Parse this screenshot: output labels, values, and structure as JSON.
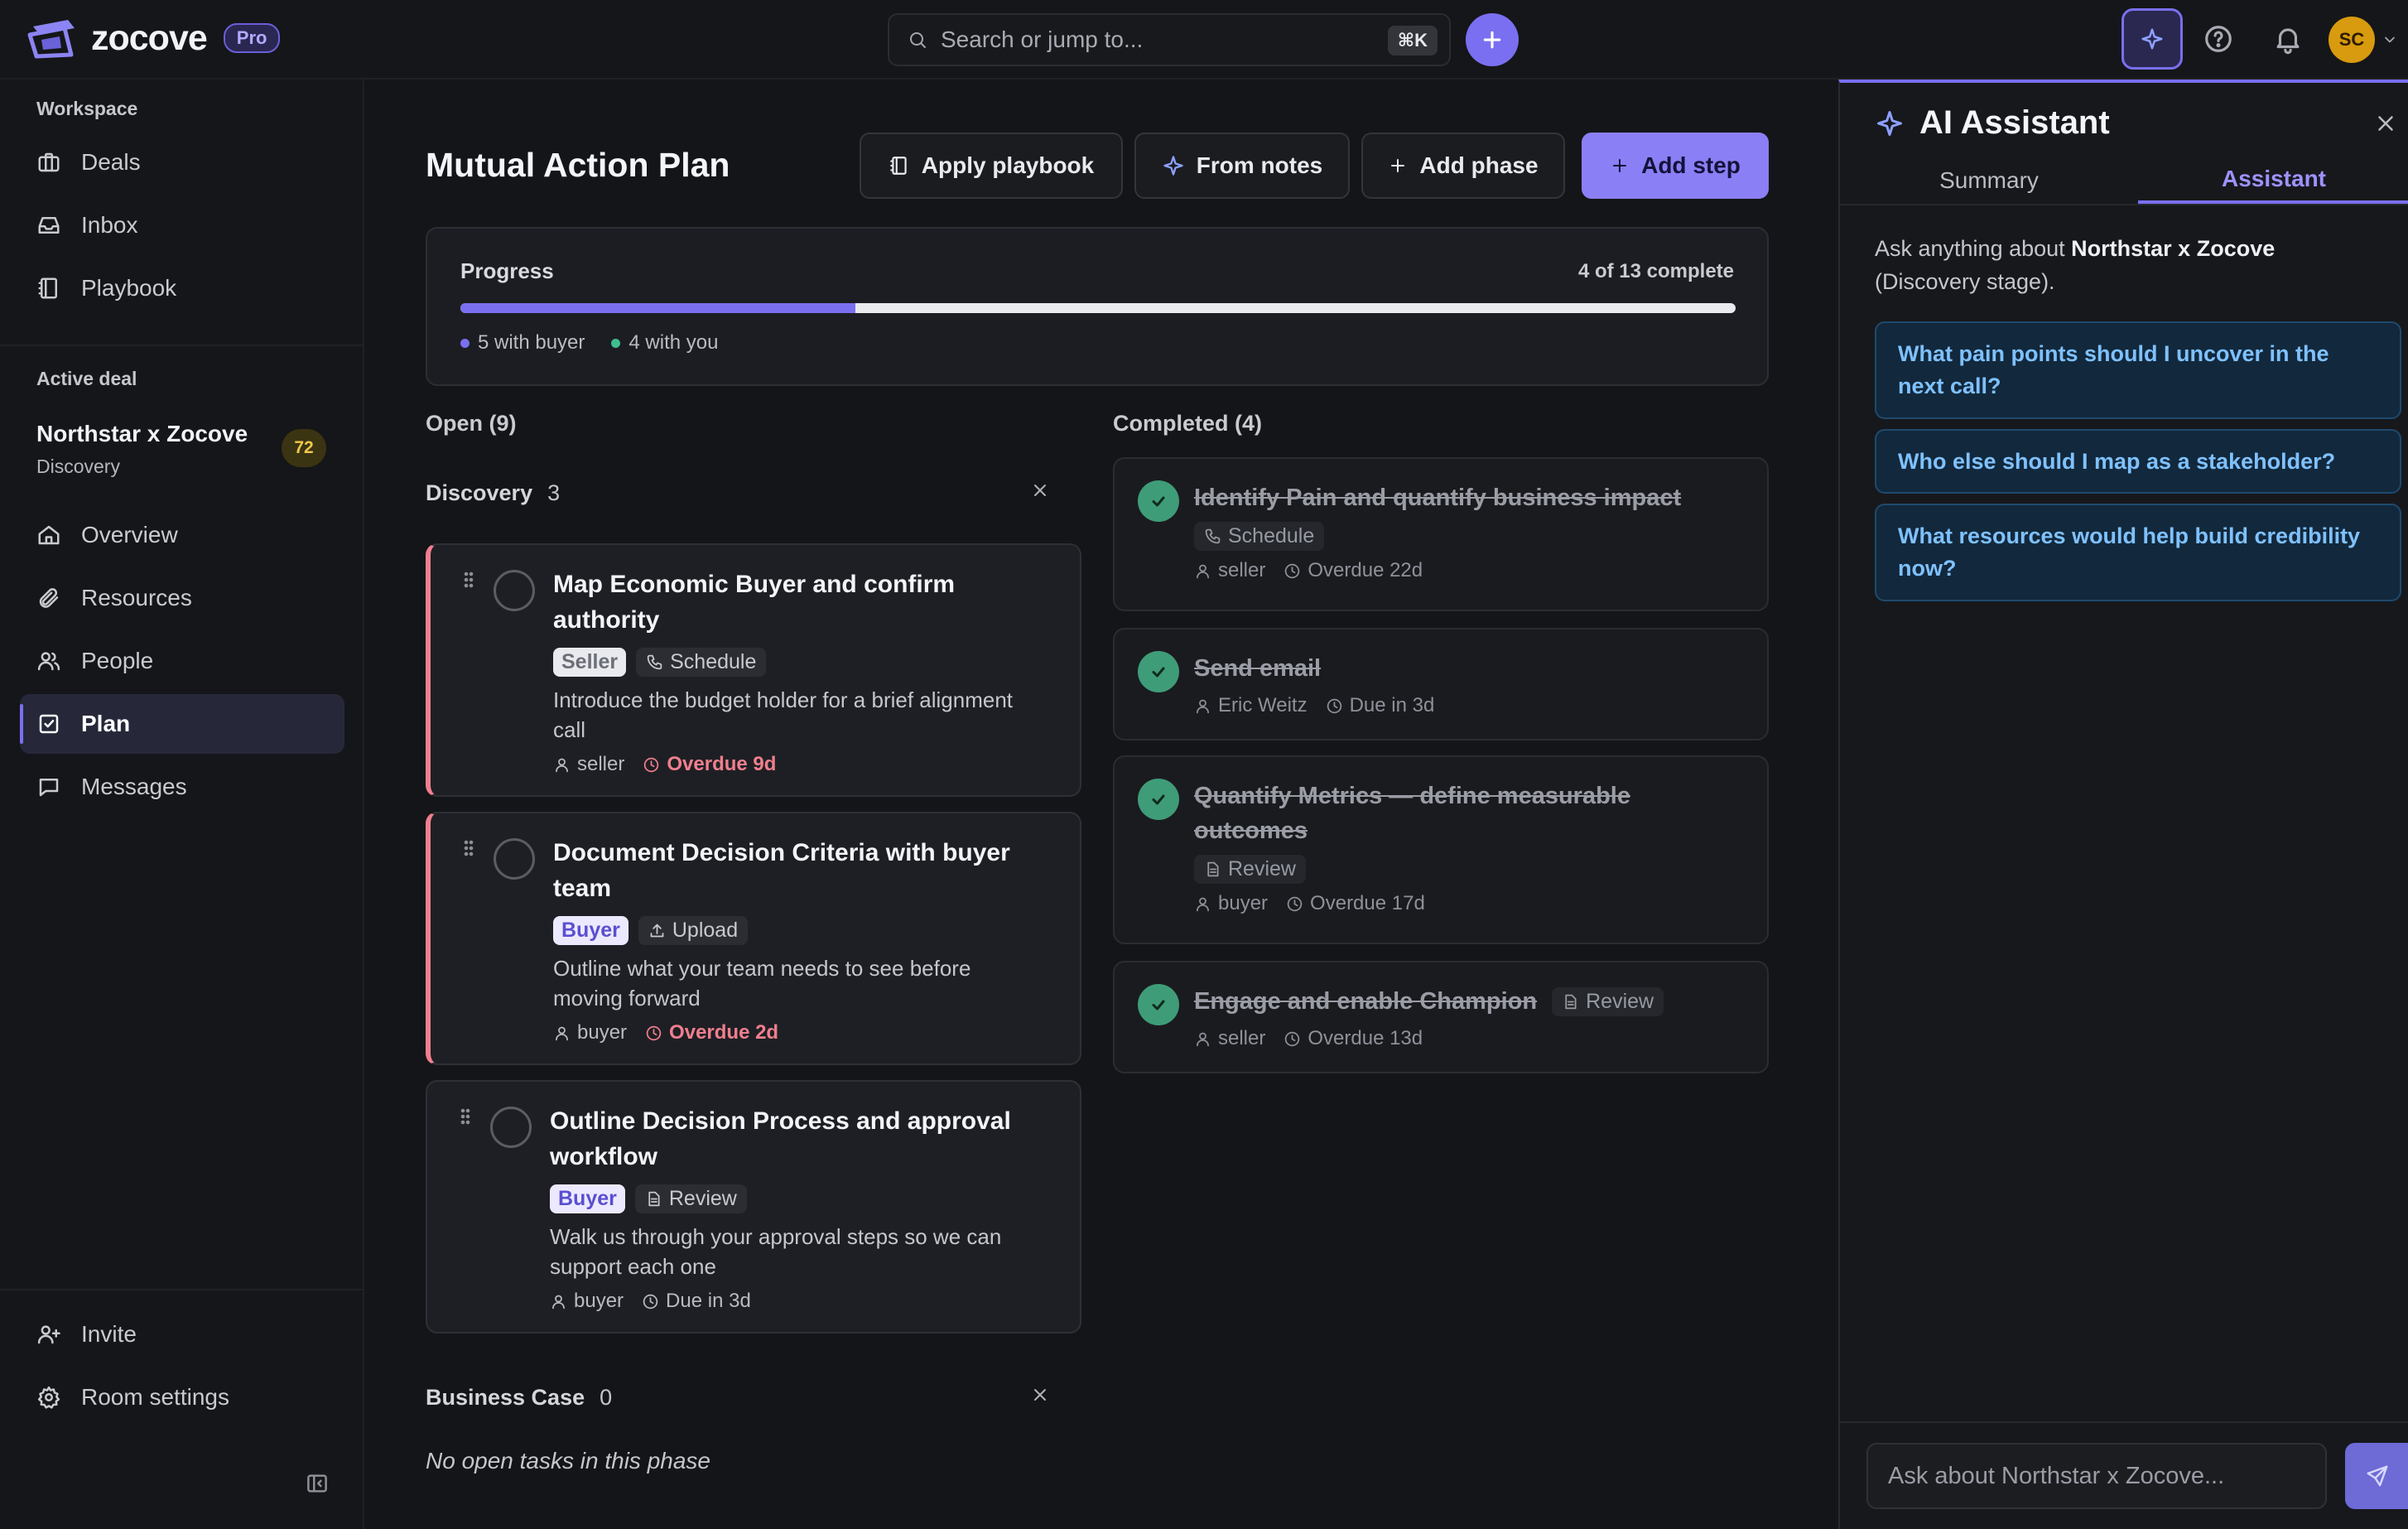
{
  "app": {
    "name": "zocove",
    "badge": "Pro"
  },
  "search": {
    "placeholder": "Search or jump to...",
    "shortcut": "⌘K"
  },
  "user": {
    "initials": "SC"
  },
  "sidebar": {
    "workspace_label": "Workspace",
    "workspace_items": [
      {
        "label": "Deals",
        "icon": "briefcase-icon"
      },
      {
        "label": "Inbox",
        "icon": "inbox-icon"
      },
      {
        "label": "Playbook",
        "icon": "book-icon"
      }
    ],
    "active_deal_label": "Active deal",
    "deal": {
      "name": "Northstar x Zocove",
      "stage": "Discovery",
      "score": "72"
    },
    "deal_items": [
      {
        "label": "Overview",
        "icon": "home-icon"
      },
      {
        "label": "Resources",
        "icon": "paperclip-icon"
      },
      {
        "label": "People",
        "icon": "people-icon"
      },
      {
        "label": "Plan",
        "icon": "checklist-icon",
        "active": true
      },
      {
        "label": "Messages",
        "icon": "message-icon"
      }
    ],
    "footer_items": [
      {
        "label": "Invite",
        "icon": "user-plus-icon"
      },
      {
        "label": "Room settings",
        "icon": "gear-icon"
      }
    ]
  },
  "main": {
    "title": "Mutual Action Plan",
    "toolbar": {
      "apply_playbook": "Apply playbook",
      "from_notes": "From notes",
      "add_phase": "Add phase",
      "add_step": "Add step"
    },
    "progress": {
      "label": "Progress",
      "count_text": "4 of 13 complete",
      "fraction": 0.31,
      "legend": [
        {
          "text": "5 with buyer",
          "color": "#7a6ff0"
        },
        {
          "text": "4 with you",
          "color": "#3fbf8f"
        }
      ]
    },
    "open_header": "Open (9)",
    "completed_header": "Completed (4)",
    "phases": [
      {
        "name": "Discovery",
        "count": "3",
        "tasks": [
          {
            "title": "Map Economic Buyer and confirm authority",
            "role": "Seller",
            "action": "Schedule",
            "desc": "Introduce the budget holder for a brief alignment call",
            "owner": "seller",
            "due": "Overdue 9d"
          },
          {
            "title": "Document Decision Criteria with buyer team",
            "role": "Buyer",
            "action": "Upload",
            "desc": "Outline what your team needs to see before moving forward",
            "owner": "buyer",
            "due": "Overdue 2d"
          },
          {
            "title": "Outline Decision Process and approval workflow",
            "role": "Buyer",
            "action": "Review",
            "desc": "Walk us through your approval steps so we can support each one",
            "owner": "buyer",
            "due": "Due in 3d"
          }
        ]
      },
      {
        "name": "Business Case",
        "count": "0",
        "empty_text": "No open tasks in this phase"
      }
    ],
    "completed": [
      {
        "title": "Identify Pain and quantify business impact",
        "action": "Schedule",
        "owner": "seller",
        "due": "Overdue 22d"
      },
      {
        "title": "Send email",
        "owner": "Eric Weitz",
        "due": "Due in 3d"
      },
      {
        "title": "Quantify Metrics — define measurable outcomes",
        "action": "Review",
        "owner": "buyer",
        "due": "Overdue 17d"
      },
      {
        "title": "Engage and enable Champion",
        "action": "Review",
        "owner": "seller",
        "due": "Overdue 13d"
      }
    ]
  },
  "ai": {
    "title": "AI Assistant",
    "tabs": [
      "Summary",
      "Assistant"
    ],
    "active_tab": "Assistant",
    "intro_prefix": "Ask anything about ",
    "intro_deal": "Northstar x Zocove",
    "intro_suffix": " (Discovery stage).",
    "suggestions": [
      "What pain points should I uncover in the next call?",
      "Who else should I map as a stakeholder?",
      "What resources would help build credibility now?"
    ],
    "input_placeholder": "Ask about Northstar x Zocove..."
  }
}
